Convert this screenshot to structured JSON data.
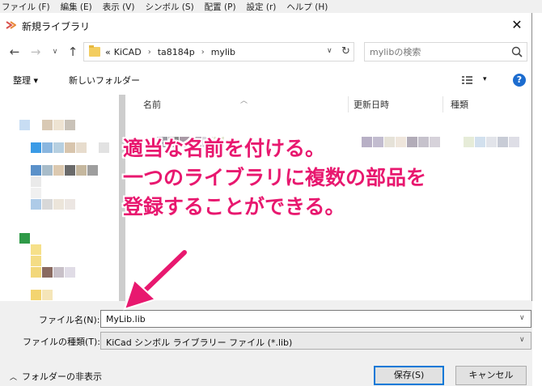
{
  "parent_menu": [
    "ファイル (F)",
    "編集 (E)",
    "表示 (V)",
    "シンボル (S)",
    "配置 (P)",
    "設定 (r)",
    "ヘルプ (H)"
  ],
  "dialog": {
    "title": "新規ライブラリ",
    "address": {
      "prefix": "«",
      "crumbs": [
        "KiCAD",
        "ta8184p",
        "mylib"
      ]
    },
    "search": {
      "placeholder": "mylibの検索"
    },
    "toolbar": {
      "organize": "整理 ▾",
      "new_folder": "新しいフォルダー"
    },
    "columns": {
      "name": "名前",
      "modified": "更新日時",
      "type": "種類"
    },
    "filename_label": "ファイル名(N):",
    "filename_value": "MyLib.lib",
    "filetype_label": "ファイルの種類(T):",
    "filetype_value": "KiCad シンボル ライブラリー ファイル (*.lib)",
    "hide_folders": "フォルダーの非表示",
    "save_button": "保存(S)",
    "cancel_button": "キャンセル"
  },
  "annotation": {
    "lines": [
      "適当な名前を付ける。",
      "一つのライブラリに複数の部品を",
      "登録することができる。"
    ],
    "color": "#e8186f"
  }
}
